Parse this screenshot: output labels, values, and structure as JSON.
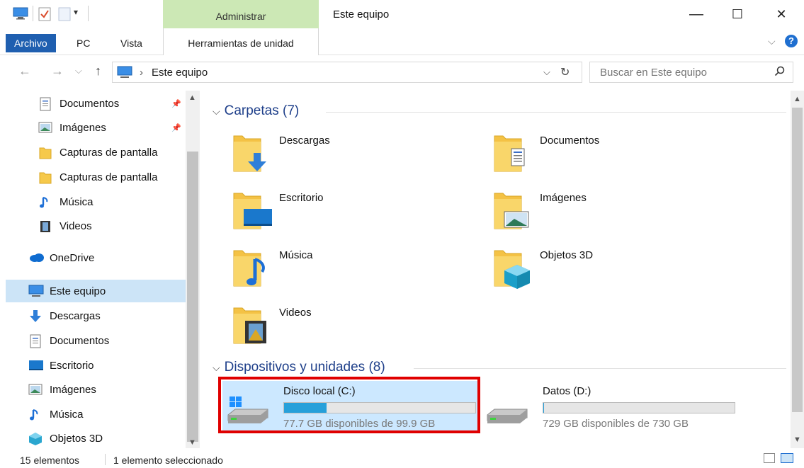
{
  "window": {
    "title": "Este equipo",
    "contextual_group": "Administrar",
    "minimize": "—",
    "maximize": "☐",
    "close": "✕"
  },
  "ribbon": {
    "tabs": [
      "Archivo",
      "PC",
      "Vista"
    ],
    "contextual_tab": "Herramientas de unidad"
  },
  "navigation": {
    "back": "←",
    "forward": "→",
    "recent": "⌵",
    "up": "↑",
    "breadcrumb_sep": "›",
    "breadcrumb": "Este equipo",
    "dropdown": "⌵",
    "refresh": "↻",
    "search_placeholder": "Buscar en Este equipo"
  },
  "sidebar": {
    "items": [
      {
        "label": "Documentos",
        "icon": "document-icon",
        "pinned": true
      },
      {
        "label": "Imágenes",
        "icon": "pictures-icon",
        "pinned": true
      },
      {
        "label": "Capturas de pantalla",
        "icon": "folder-icon",
        "pinned": false
      },
      {
        "label": "Capturas de pantalla",
        "icon": "folder-icon",
        "pinned": false
      },
      {
        "label": "Música",
        "icon": "music-icon",
        "pinned": false
      },
      {
        "label": "Videos",
        "icon": "video-icon",
        "pinned": false
      },
      {
        "label": "OneDrive",
        "icon": "cloud-icon",
        "pinned": false
      },
      {
        "label": "Este equipo",
        "icon": "pc-icon",
        "pinned": false,
        "selected": true
      },
      {
        "label": "Descargas",
        "icon": "download-icon",
        "pinned": false
      },
      {
        "label": "Documentos",
        "icon": "document-icon",
        "pinned": false
      },
      {
        "label": "Escritorio",
        "icon": "desktop-icon",
        "pinned": false
      },
      {
        "label": "Imágenes",
        "icon": "pictures-icon",
        "pinned": false
      },
      {
        "label": "Música",
        "icon": "music-icon",
        "pinned": false
      },
      {
        "label": "Objetos 3D",
        "icon": "cube-icon",
        "pinned": false
      }
    ]
  },
  "folders_section": {
    "title": "Carpetas (7)",
    "items": [
      {
        "name": "Descargas",
        "icon": "download-icon"
      },
      {
        "name": "Documentos",
        "icon": "document-icon"
      },
      {
        "name": "Escritorio",
        "icon": "desktop-icon"
      },
      {
        "name": "Imágenes",
        "icon": "pictures-icon"
      },
      {
        "name": "Música",
        "icon": "music-icon"
      },
      {
        "name": "Objetos 3D",
        "icon": "cube-icon"
      },
      {
        "name": "Videos",
        "icon": "video-icon"
      }
    ]
  },
  "devices_section": {
    "title": "Dispositivos y unidades (8)",
    "drives": [
      {
        "name": "Disco local (C:)",
        "free": "77.7 GB disponibles de 99.9 GB",
        "used_fraction": 0.222,
        "selected": true
      },
      {
        "name": "Datos (D:)",
        "free": "729 GB disponibles de 730 GB",
        "used_fraction": 0.0014,
        "selected": false
      }
    ]
  },
  "status": {
    "count": "15 elementos",
    "selection": "1 elemento seleccionado"
  },
  "colors": {
    "accent": "#1f5fb0",
    "contextual": "#cce8b5",
    "selection": "#cce8ff",
    "progress": "#26a0da",
    "highlight": "#e00000"
  }
}
